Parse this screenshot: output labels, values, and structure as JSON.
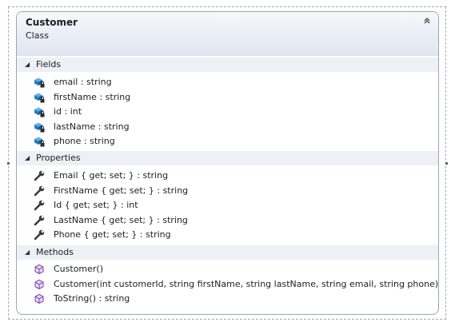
{
  "class": {
    "name": "Customer",
    "kind": "Class"
  },
  "sections": {
    "fields": {
      "label": "Fields",
      "items": [
        "email : string",
        "firstName : string",
        "id : int",
        "lastName : string",
        "phone : string"
      ]
    },
    "properties": {
      "label": "Properties",
      "items": [
        "Email { get; set; } : string",
        "FirstName { get; set; } : string",
        "Id { get; set; } : int",
        "LastName { get; set; } : string",
        "Phone { get; set; } : string"
      ]
    },
    "methods": {
      "label": "Methods",
      "items": [
        "Customer()",
        "Customer(int customerId, string firstName, string lastName, string email, string phone)",
        "ToString() : string"
      ]
    }
  },
  "icons": {
    "collapse": "double-chevron-up-icon",
    "section_toggle": "triangle-expanded-icon",
    "field": "private-field-icon",
    "property": "wrench-property-icon",
    "method": "method-cube-icon"
  },
  "colors": {
    "field_blue": "#1f7fc4",
    "method_purple": "#7a3fb0",
    "wrench": "#3a3a3a"
  }
}
